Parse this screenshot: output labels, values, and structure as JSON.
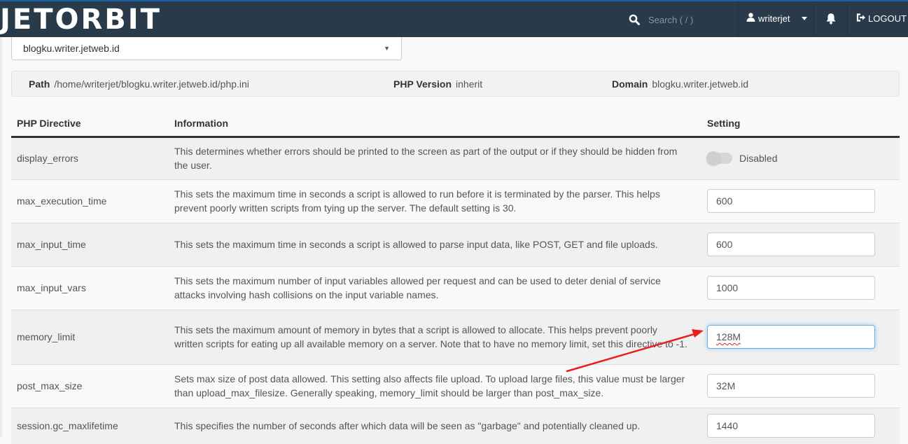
{
  "header": {
    "logo": "JETORBIT",
    "search_placeholder": "Search ( / )",
    "username": "writerjet",
    "logout_label": "LOGOUT"
  },
  "domain_select": {
    "selected": "blogku.writer.jetweb.id"
  },
  "info_bar": {
    "path_label": "Path",
    "path_value": "/home/writerjet/blogku.writer.jetweb.id/php.ini",
    "php_version_label": "PHP Version",
    "php_version_value": "inherit",
    "domain_label": "Domain",
    "domain_value": "blogku.writer.jetweb.id"
  },
  "table": {
    "headers": [
      "PHP Directive",
      "Information",
      "Setting"
    ],
    "rows": [
      {
        "directive": "display_errors",
        "info": "This determines whether errors should be printed to the screen as part of the output or if they should be hidden from the user.",
        "setting_type": "toggle",
        "setting": "Disabled",
        "enabled": false
      },
      {
        "directive": "max_execution_time",
        "info": "This sets the maximum time in seconds a script is allowed to run before it is terminated by the parser. This helps prevent poorly written scripts from tying up the server. The default setting is 30.",
        "setting_type": "input",
        "setting": "600"
      },
      {
        "directive": "max_input_time",
        "info": "This sets the maximum time in seconds a script is allowed to parse input data, like POST, GET and file uploads.",
        "setting_type": "input",
        "setting": "600"
      },
      {
        "directive": "max_input_vars",
        "info": "This sets the maximum number of input variables allowed per request and can be used to deter denial of service attacks involving hash collisions on the input variable names.",
        "setting_type": "input",
        "setting": "1000"
      },
      {
        "directive": "memory_limit",
        "info": "This sets the maximum amount of memory in bytes that a script is allowed to allocate. This helps prevent poorly written scripts for eating up all available memory on a server. Note that to have no memory limit, set this directive to -1.",
        "setting_type": "input",
        "setting": "128M",
        "focused": true
      },
      {
        "directive": "post_max_size",
        "info": "Sets max size of post data allowed. This setting also affects file upload. To upload large files, this value must be larger than upload_max_filesize. Generally speaking, memory_limit should be larger than post_max_size.",
        "setting_type": "input",
        "setting": "32M"
      },
      {
        "directive": "session.gc_maxlifetime",
        "info": "This specifies the number of seconds after which data will be seen as \"garbage\" and potentially cleaned up.",
        "setting_type": "input",
        "setting": "1440"
      }
    ]
  },
  "annotation": {
    "color": "#e8201c",
    "points_to": "memory_limit setting"
  }
}
